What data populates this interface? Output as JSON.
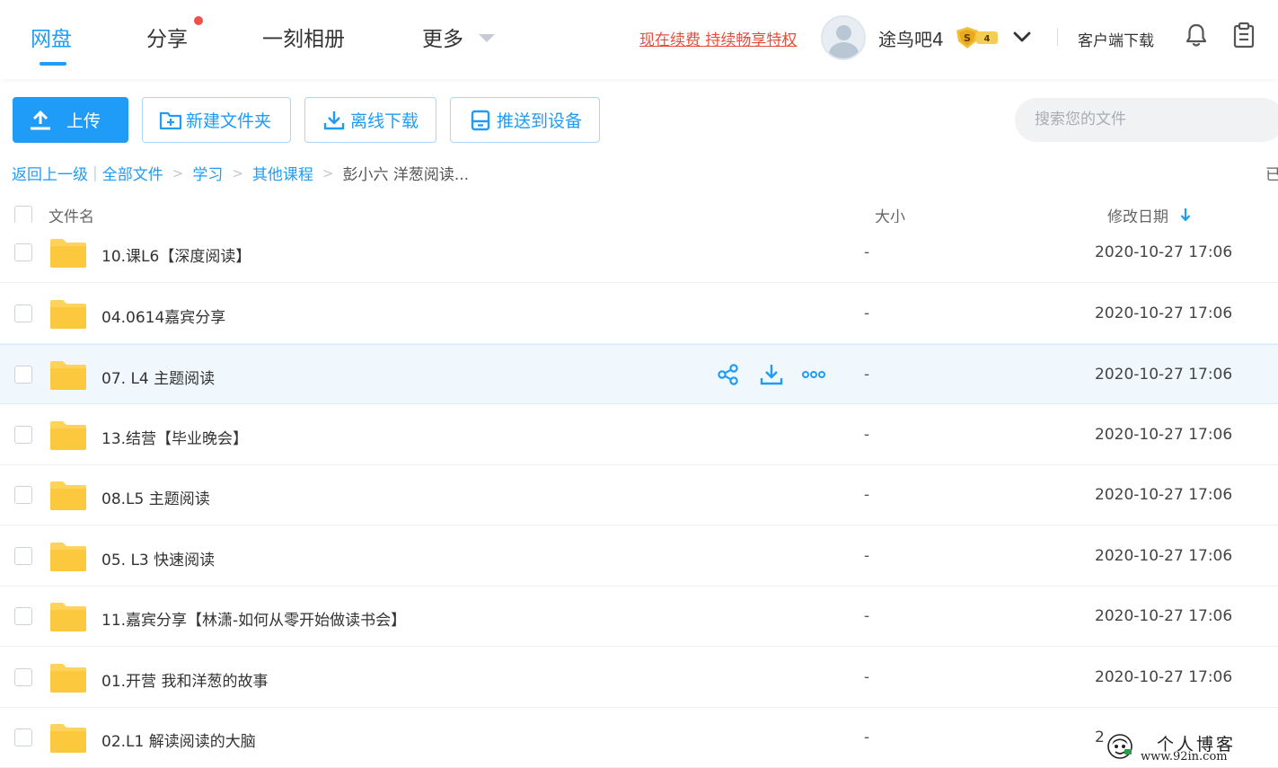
{
  "nav": {
    "tabs": [
      {
        "label": "网盘",
        "active": true
      },
      {
        "label": "分享",
        "active": false
      },
      {
        "label": "一刻相册",
        "active": false
      },
      {
        "label": "更多",
        "active": false
      }
    ],
    "renew_link": "现在续费 持续畅享特权",
    "username": "途鸟吧4",
    "vip_level": "4",
    "vip_letter": "S",
    "client_download": "客户端下载"
  },
  "toolbar": {
    "upload": "上传",
    "new_folder": "新建文件夹",
    "offline_download": "离线下载",
    "push_to_device": "推送到设备",
    "search_placeholder": "搜索您的文件"
  },
  "breadcrumb": {
    "back": "返回上一级",
    "all_files": "全部文件",
    "level1": "学习",
    "level2": "其他课程",
    "current": "彭小六 洋葱阅读...",
    "edge_text": "已"
  },
  "table": {
    "col_name": "文件名",
    "col_size": "大小",
    "col_date": "修改日期",
    "rows": [
      {
        "name": "10.课L6【深度阅读】",
        "size": "-",
        "date": "2020-10-27 17:06"
      },
      {
        "name": "04.0614嘉宾分享",
        "size": "-",
        "date": "2020-10-27 17:06"
      },
      {
        "name": "07. L4 主题阅读",
        "size": "-",
        "date": "2020-10-27 17:06"
      },
      {
        "name": "13.结营【毕业晚会】",
        "size": "-",
        "date": "2020-10-27 17:06"
      },
      {
        "name": "08.L5 主题阅读",
        "size": "-",
        "date": "2020-10-27 17:06"
      },
      {
        "name": "05. L3 快速阅读",
        "size": "-",
        "date": "2020-10-27 17:06"
      },
      {
        "name": "11.嘉宾分享【林潇-如何从零开始做读书会】",
        "size": "-",
        "date": "2020-10-27 17:06"
      },
      {
        "name": "01.开营 我和洋葱的故事",
        "size": "-",
        "date": "2020-10-27 17:06"
      },
      {
        "name": "02.L1 解读阅读的大脑",
        "size": "-",
        "date": "2"
      }
    ]
  },
  "watermark": {
    "title": "个人博客",
    "url": "www.92in.com"
  },
  "colors": {
    "accent": "#1e9cf8",
    "renew": "#e84d3c",
    "folder": "#fdd35c",
    "notification_dot": "#f0504a"
  }
}
